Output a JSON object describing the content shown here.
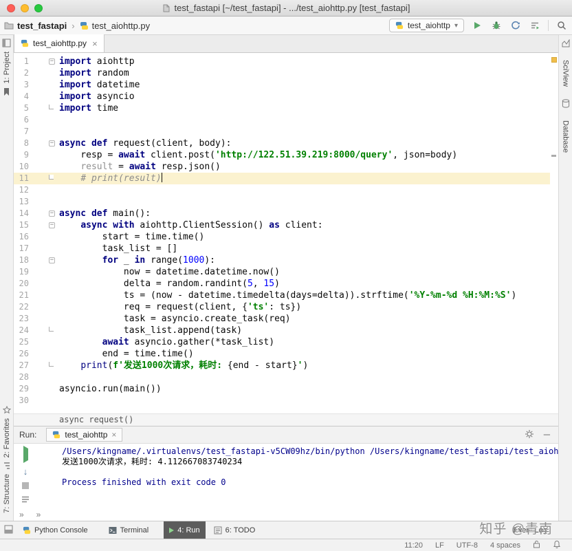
{
  "titlebar": {
    "title": "test_fastapi [~/test_fastapi] - .../test_aiohttp.py [test_fastapi]"
  },
  "navbar": {
    "project": "test_fastapi",
    "file": "test_aiohttp.py",
    "run_config": "test_aiohttp"
  },
  "editor_tab": {
    "label": "test_aiohttp.py",
    "close": "×"
  },
  "left_stripe": {
    "top": [
      "1: Project"
    ],
    "bottom": [
      "2: Favorites",
      "7: Structure"
    ]
  },
  "right_stripe": [
    "SciView",
    "Database"
  ],
  "editor": {
    "current_line": 11,
    "context_bar": "async request()",
    "lines": [
      {
        "n": 1,
        "fold": "start",
        "t": [
          [
            "kw",
            "import"
          ],
          [
            "p",
            " aiohttp"
          ]
        ]
      },
      {
        "n": 2,
        "t": [
          [
            "kw",
            "import"
          ],
          [
            "p",
            " random"
          ]
        ]
      },
      {
        "n": 3,
        "t": [
          [
            "kw",
            "import"
          ],
          [
            "p",
            " datetime"
          ]
        ]
      },
      {
        "n": 4,
        "t": [
          [
            "kw",
            "import"
          ],
          [
            "p",
            " asyncio"
          ]
        ]
      },
      {
        "n": 5,
        "fold": "end",
        "t": [
          [
            "kw",
            "import"
          ],
          [
            "p",
            " time"
          ]
        ]
      },
      {
        "n": 6,
        "t": []
      },
      {
        "n": 7,
        "t": []
      },
      {
        "n": 8,
        "fold": "start",
        "t": [
          [
            "kw",
            "async"
          ],
          [
            "p",
            " "
          ],
          [
            "kw",
            "def"
          ],
          [
            "p",
            " request(client, body):"
          ]
        ]
      },
      {
        "n": 9,
        "t": [
          [
            "p",
            "    resp = "
          ],
          [
            "kw",
            "await"
          ],
          [
            "p",
            " client.post("
          ],
          [
            "str",
            "'http://122.51.39.219:8000/query'"
          ],
          [
            "p",
            ", json=body)"
          ]
        ]
      },
      {
        "n": 10,
        "t": [
          [
            "p",
            "    "
          ],
          [
            "gray",
            "result"
          ],
          [
            "p",
            " = "
          ],
          [
            "kw",
            "await"
          ],
          [
            "p",
            " resp.json()"
          ]
        ]
      },
      {
        "n": 11,
        "fold": "end",
        "caret": true,
        "t": [
          [
            "p",
            "    "
          ],
          [
            "com",
            "# print(result)"
          ]
        ]
      },
      {
        "n": 12,
        "t": []
      },
      {
        "n": 13,
        "t": []
      },
      {
        "n": 14,
        "fold": "start",
        "t": [
          [
            "kw",
            "async"
          ],
          [
            "p",
            " "
          ],
          [
            "kw",
            "def"
          ],
          [
            "p",
            " main():"
          ]
        ]
      },
      {
        "n": 15,
        "fold": "start",
        "t": [
          [
            "p",
            "    "
          ],
          [
            "kw",
            "async"
          ],
          [
            "p",
            " "
          ],
          [
            "kw",
            "with"
          ],
          [
            "p",
            " aiohttp.ClientSession() "
          ],
          [
            "kw",
            "as"
          ],
          [
            "p",
            " client:"
          ]
        ]
      },
      {
        "n": 16,
        "t": [
          [
            "p",
            "        start = time.time()"
          ]
        ]
      },
      {
        "n": 17,
        "t": [
          [
            "p",
            "        task_list = []"
          ]
        ]
      },
      {
        "n": 18,
        "fold": "start",
        "t": [
          [
            "p",
            "        "
          ],
          [
            "kw",
            "for"
          ],
          [
            "p",
            " _ "
          ],
          [
            "kw",
            "in"
          ],
          [
            "p",
            " range("
          ],
          [
            "num",
            "1000"
          ],
          [
            "p",
            "):"
          ]
        ]
      },
      {
        "n": 19,
        "t": [
          [
            "p",
            "            now = datetime.datetime.now()"
          ]
        ]
      },
      {
        "n": 20,
        "t": [
          [
            "p",
            "            delta = random.randint("
          ],
          [
            "num",
            "5"
          ],
          [
            "p",
            ", "
          ],
          [
            "num",
            "15"
          ],
          [
            "p",
            ")"
          ]
        ]
      },
      {
        "n": 21,
        "t": [
          [
            "p",
            "            ts = (now - datetime.timedelta(days=delta)).strftime("
          ],
          [
            "str",
            "'%Y-%m-%d %H:%M:%S'"
          ],
          [
            "p",
            ")"
          ]
        ]
      },
      {
        "n": 22,
        "t": [
          [
            "p",
            "            req = request(client, {"
          ],
          [
            "str",
            "'ts'"
          ],
          [
            "p",
            ": ts})"
          ]
        ]
      },
      {
        "n": 23,
        "t": [
          [
            "p",
            "            task = asyncio.create_task(req)"
          ]
        ]
      },
      {
        "n": 24,
        "fold": "end",
        "t": [
          [
            "p",
            "            task_list.append(task)"
          ]
        ]
      },
      {
        "n": 25,
        "t": [
          [
            "p",
            "        "
          ],
          [
            "kw",
            "await"
          ],
          [
            "p",
            " asyncio.gather(*task_list)"
          ]
        ]
      },
      {
        "n": 26,
        "t": [
          [
            "p",
            "        end = time.time()"
          ]
        ]
      },
      {
        "n": 27,
        "fold": "end",
        "t": [
          [
            "p",
            "    "
          ],
          [
            "builtin",
            "print"
          ],
          [
            "p",
            "("
          ],
          [
            "str",
            "f'发送1000次请求，耗时: "
          ],
          [
            "p",
            "{end - start}"
          ],
          [
            "str",
            "'"
          ],
          [
            "p",
            ")"
          ]
        ]
      },
      {
        "n": 28,
        "t": []
      },
      {
        "n": 29,
        "t": [
          [
            "p",
            "asyncio.run(main())"
          ]
        ]
      },
      {
        "n": 30,
        "t": []
      }
    ]
  },
  "run_panel": {
    "label": "Run:",
    "tab": "test_aiohttp",
    "tab_close": "×",
    "console": [
      {
        "type": "system",
        "text": "/Users/kingname/.virtualenvs/test_fastapi-v5CW09hz/bin/python /Users/kingname/test_fastapi/test_aiohttp"
      },
      {
        "type": "stdout",
        "text": "发送1000次请求，耗时: 4.112667083740234"
      },
      {
        "type": "stdout",
        "text": ""
      },
      {
        "type": "system",
        "text": "Process finished with exit code 0"
      }
    ]
  },
  "toolwindow_bar": {
    "items": [
      "Python Console",
      "Terminal",
      "4: Run",
      "6: TODO"
    ],
    "event_log": "Event Log",
    "watermark": "知乎 @青南"
  },
  "statusbar": {
    "position": "11:20",
    "line_sep": "LF",
    "encoding": "UTF-8",
    "indent": "4 spaces"
  }
}
